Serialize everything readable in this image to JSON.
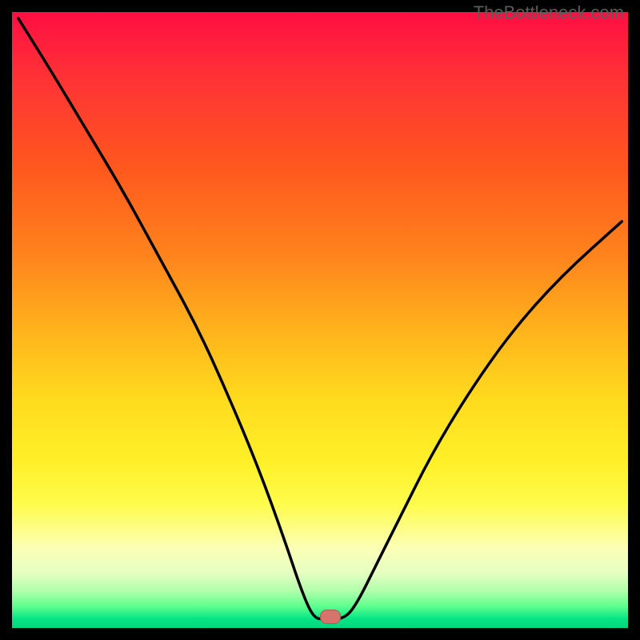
{
  "watermark": "TheBottleneck.com",
  "marker": {
    "x_pct": 51.5,
    "y_pct": 98.0
  },
  "chart_data": {
    "type": "line",
    "title": "",
    "xlabel": "",
    "ylabel": "",
    "xlim": [
      0,
      100
    ],
    "ylim": [
      0,
      100
    ],
    "note": "V-shaped bottleneck curve over a red-to-green vertical gradient; minimum near x≈51 at the bottom (green band), rising steeply on both sides; left branch starts at top-left corner, right branch ends partway up the right edge.",
    "series": [
      {
        "name": "bottleneck-curve",
        "values": [
          {
            "x": 1,
            "y": 99
          },
          {
            "x": 6,
            "y": 91
          },
          {
            "x": 12,
            "y": 81
          },
          {
            "x": 18,
            "y": 71
          },
          {
            "x": 24,
            "y": 60
          },
          {
            "x": 30,
            "y": 49
          },
          {
            "x": 35,
            "y": 38
          },
          {
            "x": 40,
            "y": 26
          },
          {
            "x": 44,
            "y": 15
          },
          {
            "x": 47,
            "y": 6
          },
          {
            "x": 49,
            "y": 1.5
          },
          {
            "x": 51,
            "y": 1.5
          },
          {
            "x": 54,
            "y": 1.5
          },
          {
            "x": 56,
            "y": 4
          },
          {
            "x": 59,
            "y": 10
          },
          {
            "x": 63,
            "y": 18
          },
          {
            "x": 68,
            "y": 28
          },
          {
            "x": 74,
            "y": 38
          },
          {
            "x": 81,
            "y": 48
          },
          {
            "x": 89,
            "y": 57
          },
          {
            "x": 99,
            "y": 66
          }
        ]
      }
    ],
    "background_gradient": {
      "direction": "vertical",
      "stops": [
        {
          "pct": 0,
          "color": "#ff0e43"
        },
        {
          "pct": 10,
          "color": "#ff3036"
        },
        {
          "pct": 25,
          "color": "#ff571e"
        },
        {
          "pct": 40,
          "color": "#ff851c"
        },
        {
          "pct": 52,
          "color": "#ffb41c"
        },
        {
          "pct": 63,
          "color": "#ffdb1e"
        },
        {
          "pct": 73,
          "color": "#fff028"
        },
        {
          "pct": 80,
          "color": "#fffc4d"
        },
        {
          "pct": 87,
          "color": "#fcffb4"
        },
        {
          "pct": 91,
          "color": "#e5ffc1"
        },
        {
          "pct": 94,
          "color": "#b0ffab"
        },
        {
          "pct": 96.5,
          "color": "#5eff8f"
        },
        {
          "pct": 98.5,
          "color": "#06e585"
        },
        {
          "pct": 100,
          "color": "#00d77e"
        }
      ]
    }
  }
}
